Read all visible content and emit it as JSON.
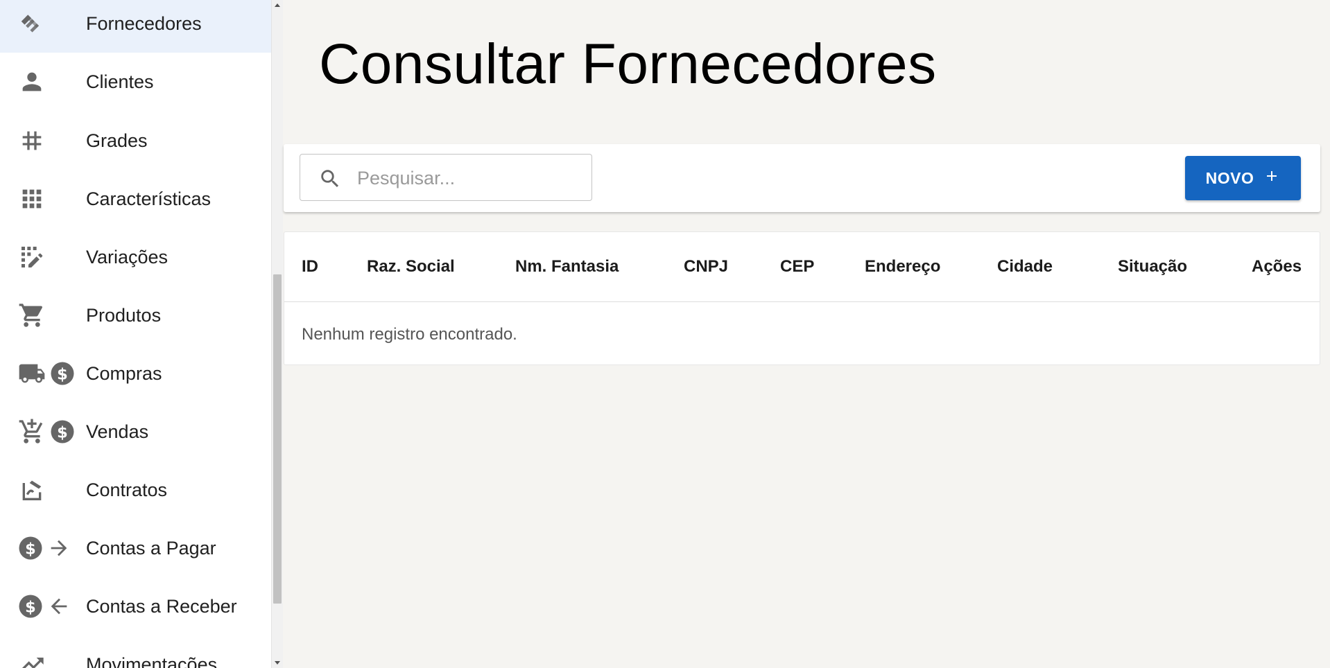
{
  "sidebar": {
    "items": [
      {
        "label": "Fornecedores",
        "icon": "handshake-icon",
        "active": true
      },
      {
        "label": "Clientes",
        "icon": "person-icon"
      },
      {
        "label": "Grades",
        "icon": "hash-icon"
      },
      {
        "label": "Características",
        "icon": "apps-grid-icon"
      },
      {
        "label": "Variações",
        "icon": "edit-grid-icon"
      },
      {
        "label": "Produtos",
        "icon": "shopping-cart-icon"
      },
      {
        "label": "Compras",
        "icon": "truck-dollar-icon"
      },
      {
        "label": "Vendas",
        "icon": "cart-add-dollar-icon"
      },
      {
        "label": "Contratos",
        "icon": "contract-sign-icon"
      },
      {
        "label": "Contas a Pagar",
        "icon": "dollar-arrow-right-icon"
      },
      {
        "label": "Contas a Receber",
        "icon": "dollar-arrow-left-icon"
      },
      {
        "label": "Movimentações",
        "icon": "trending-icon"
      }
    ]
  },
  "main": {
    "title": "Consultar Fornecedores",
    "search": {
      "placeholder": "Pesquisar...",
      "value": ""
    },
    "new_button": {
      "label": "NOVO",
      "icon": "plus-icon"
    },
    "table": {
      "columns": [
        "ID",
        "Raz. Social",
        "Nm. Fantasia",
        "CNPJ",
        "CEP",
        "Endereço",
        "Cidade",
        "Situação",
        "Ações"
      ],
      "rows": [],
      "empty_message": "Nenhum registro encontrado."
    }
  },
  "colors": {
    "primary": "#1565c0",
    "active_bg": "#eaf1fb",
    "page_bg": "#f5f4f1",
    "icon": "#616161"
  }
}
